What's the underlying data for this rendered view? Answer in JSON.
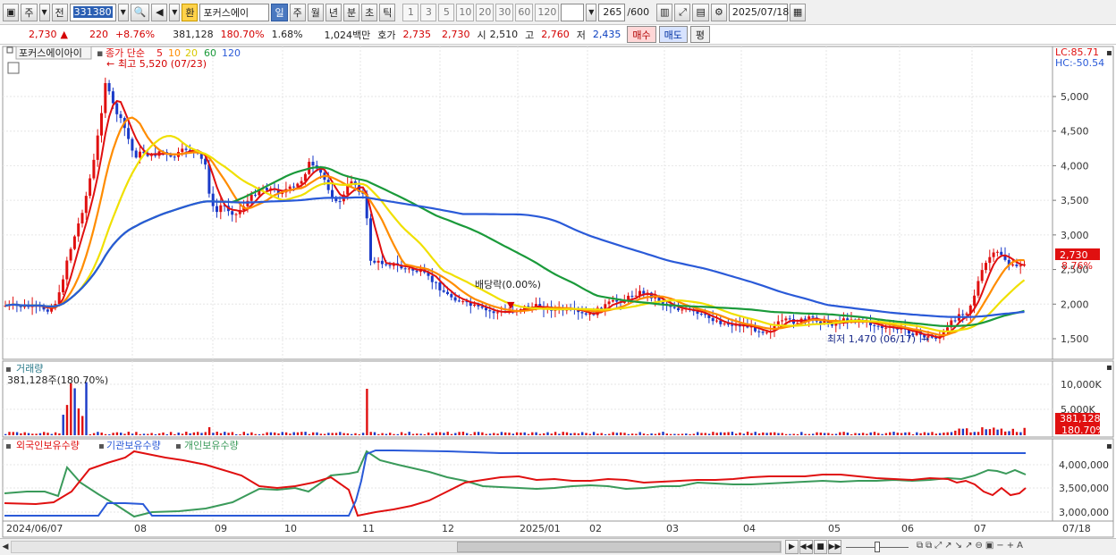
{
  "toolbar": {
    "market": "주",
    "all_label": "전",
    "stock_code": "331380",
    "hwan": "환",
    "stock_name": "포커스에이",
    "periods": [
      "일",
      "주",
      "월",
      "년",
      "분",
      "초",
      "틱"
    ],
    "selected_period": "일",
    "intervals": [
      "1",
      "3",
      "5",
      "10",
      "20",
      "30",
      "60",
      "120"
    ],
    "count_value": "265",
    "count_total": "/600",
    "date": "2025/07/18"
  },
  "quote": {
    "price": "2,730",
    "change_arrow": "▲",
    "change": "220",
    "change_pct": "+8.76%",
    "volume": "381,128",
    "volume_ratio": "180.70%",
    "turnover": "1.68%",
    "amount": "1,024백만",
    "bid_label": "호가",
    "ask_price": "2,735",
    "bid_price": "2,730",
    "open_label": "시",
    "open": "2,510",
    "high_label": "고",
    "high": "2,760",
    "low_label": "저",
    "low": "2,435",
    "buy_button": "매수",
    "sell_button": "매도",
    "eval_button": "평"
  },
  "price_panel": {
    "stock_tab": "포커스에이아이",
    "ma_legend": {
      "title": "종가 단순",
      "periods": [
        "5",
        "10",
        "20",
        "60",
        "120"
      ],
      "colors": [
        "#e01010",
        "#ff8c00",
        "#f0e000",
        "#1a9a3a",
        "#2a5ad8"
      ]
    },
    "lc": "LC:85.71",
    "hc": "HC:-50.54",
    "high_annotation": "최고 5,520 (07/23)",
    "low_annotation": "최저 1,470 (06/17)",
    "dividend_annotation": "배당락(0.00%)",
    "last_price_tag": "2,730",
    "last_pct_tag": "8.76%",
    "y_ticks": [
      "5,000",
      "4,500",
      "4,000",
      "3,500",
      "3,000",
      "2,500",
      "2,000",
      "1,500"
    ]
  },
  "volume_panel": {
    "title": "거래량",
    "value": "381,128주(180.70%)",
    "y_ticks": [
      "10,000K",
      "5,000K"
    ],
    "last_tag": "381,128",
    "last_pct_tag": "180.70%"
  },
  "holdings_panel": {
    "legends": [
      "외국인보유수량",
      "기관보유수량",
      "개인보유수량"
    ],
    "colors": [
      "#e01010",
      "#2a5ad8",
      "#3a9a5a"
    ],
    "y_ticks": [
      "4,000,000",
      "3,500,000",
      "3,000,000"
    ]
  },
  "x_axis": {
    "labels": [
      "2024/06/07",
      "08",
      "09",
      "10",
      "11",
      "12",
      "2025/01",
      "02",
      "03",
      "04",
      "05",
      "06",
      "07",
      "07/18"
    ]
  },
  "chart_data": {
    "type": "line",
    "title": "",
    "note": "approximate series read off the candlestick chart (close price)",
    "x": [
      "2024/06",
      "2024/07",
      "2024/08",
      "2024/09",
      "2024/10",
      "2024/11",
      "2024/12",
      "2025/01",
      "2025/02",
      "2025/03",
      "2025/04",
      "2025/05",
      "2025/06",
      "2025/07"
    ],
    "series": [
      {
        "name": "5",
        "values": [
          1950,
          3600,
          4200,
          3500,
          3800,
          2600,
          2000,
          1950,
          2150,
          1900,
          1700,
          1800,
          1550,
          2700
        ]
      },
      {
        "name": "120",
        "values": [
          2100,
          2250,
          2600,
          2950,
          3150,
          3300,
          3350,
          3300,
          3050,
          2650,
          2300,
          2000,
          1870,
          1900
        ]
      }
    ],
    "ylim": [
      1300,
      5700
    ],
    "volume_peak_k": 12000,
    "holdings_ylim": [
      2900000,
      4400000
    ]
  }
}
